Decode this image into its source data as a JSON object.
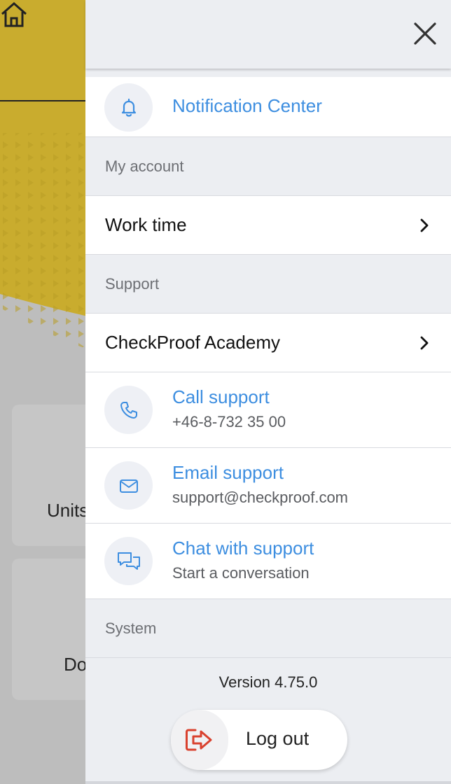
{
  "background": {
    "card_labels": [
      "Units",
      "Do"
    ],
    "accent_color": "#c9ac2e"
  },
  "drawer": {
    "close_icon": "close-icon",
    "notification": {
      "label": "Notification Center",
      "icon": "bell-icon"
    },
    "sections": {
      "my_account": "My account",
      "support": "Support",
      "system": "System"
    },
    "work_time": "Work time",
    "academy": "CheckProof Academy",
    "contacts": [
      {
        "title": "Call support",
        "subtitle": "+46-8-732 35 00",
        "icon": "phone-icon"
      },
      {
        "title": "Email support",
        "subtitle": "support@checkproof.com",
        "icon": "mail-icon"
      },
      {
        "title": "Chat with support",
        "subtitle": "Start a conversation",
        "icon": "chat-icon"
      }
    ],
    "version": "Version 4.75.0",
    "logout": {
      "label": "Log out",
      "icon": "logout-icon"
    },
    "colors": {
      "link": "#3d8ee0",
      "logout_icon": "#d9412e"
    }
  }
}
